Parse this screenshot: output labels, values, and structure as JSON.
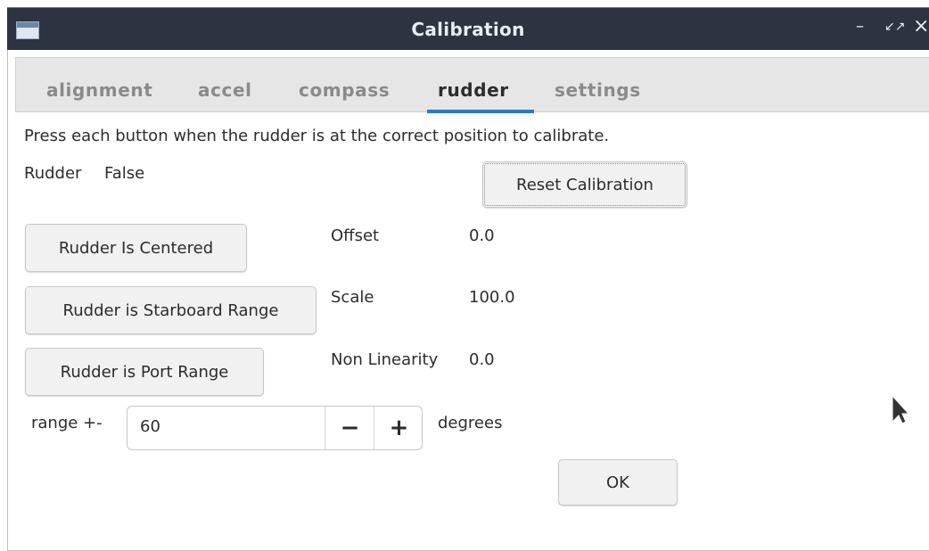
{
  "window": {
    "title": "Calibration",
    "controls": {
      "minimize": "–",
      "maximize": "↙↗",
      "close": "×"
    }
  },
  "tabs": [
    {
      "label": "alignment",
      "active": false
    },
    {
      "label": "accel",
      "active": false
    },
    {
      "label": "compass",
      "active": false
    },
    {
      "label": "rudder",
      "active": true
    },
    {
      "label": "settings",
      "active": false
    }
  ],
  "rudder": {
    "instruction": "Press each button when the rudder is at the correct position to calibrate.",
    "status_label": "Rudder",
    "status_value": "False",
    "reset_button": "Reset Calibration",
    "centered_button": "Rudder Is Centered",
    "starboard_button": "Rudder is Starboard Range",
    "port_button": "Rudder is Port Range",
    "offset_label": "Offset",
    "offset_value": "0.0",
    "scale_label": "Scale",
    "scale_value": "100.0",
    "nonlinearity_label": "Non Linearity",
    "nonlinearity_value": "0.0",
    "range_label": "range +-",
    "range_value": "60",
    "range_minus": "−",
    "range_plus": "+",
    "range_unit": "degrees",
    "ok_button": "OK"
  },
  "colors": {
    "titlebar": "#2d3340",
    "tab_underline": "#2d78c8"
  }
}
